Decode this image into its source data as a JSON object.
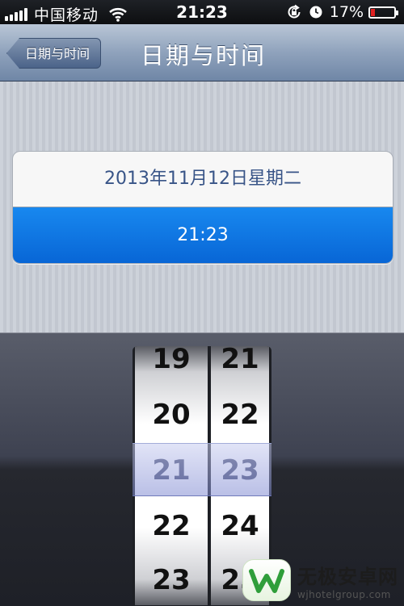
{
  "status_bar": {
    "carrier": "中国移动",
    "time": "21:23",
    "battery_percent": "17%",
    "battery_level": 0.17,
    "icons": [
      "signal-icon",
      "wifi-icon",
      "rotation-lock-icon",
      "alarm-icon",
      "battery-icon"
    ]
  },
  "nav": {
    "back_label": "日期与时间",
    "title": "日期与时间"
  },
  "settings": {
    "date_row": "2013年11月12日星期二",
    "time_row": "21:23"
  },
  "picker": {
    "hours": [
      "19",
      "20",
      "21",
      "22",
      "23"
    ],
    "minutes": [
      "21",
      "22",
      "23",
      "24",
      "25"
    ],
    "selected_hour": "21",
    "selected_minute": "23"
  },
  "watermark": {
    "name": "无极安卓网",
    "url": "wjhotelgroup.com"
  },
  "colors": {
    "selected_row": "#0a6fdc",
    "date_text": "#385487",
    "battery_low": "#e02020"
  }
}
